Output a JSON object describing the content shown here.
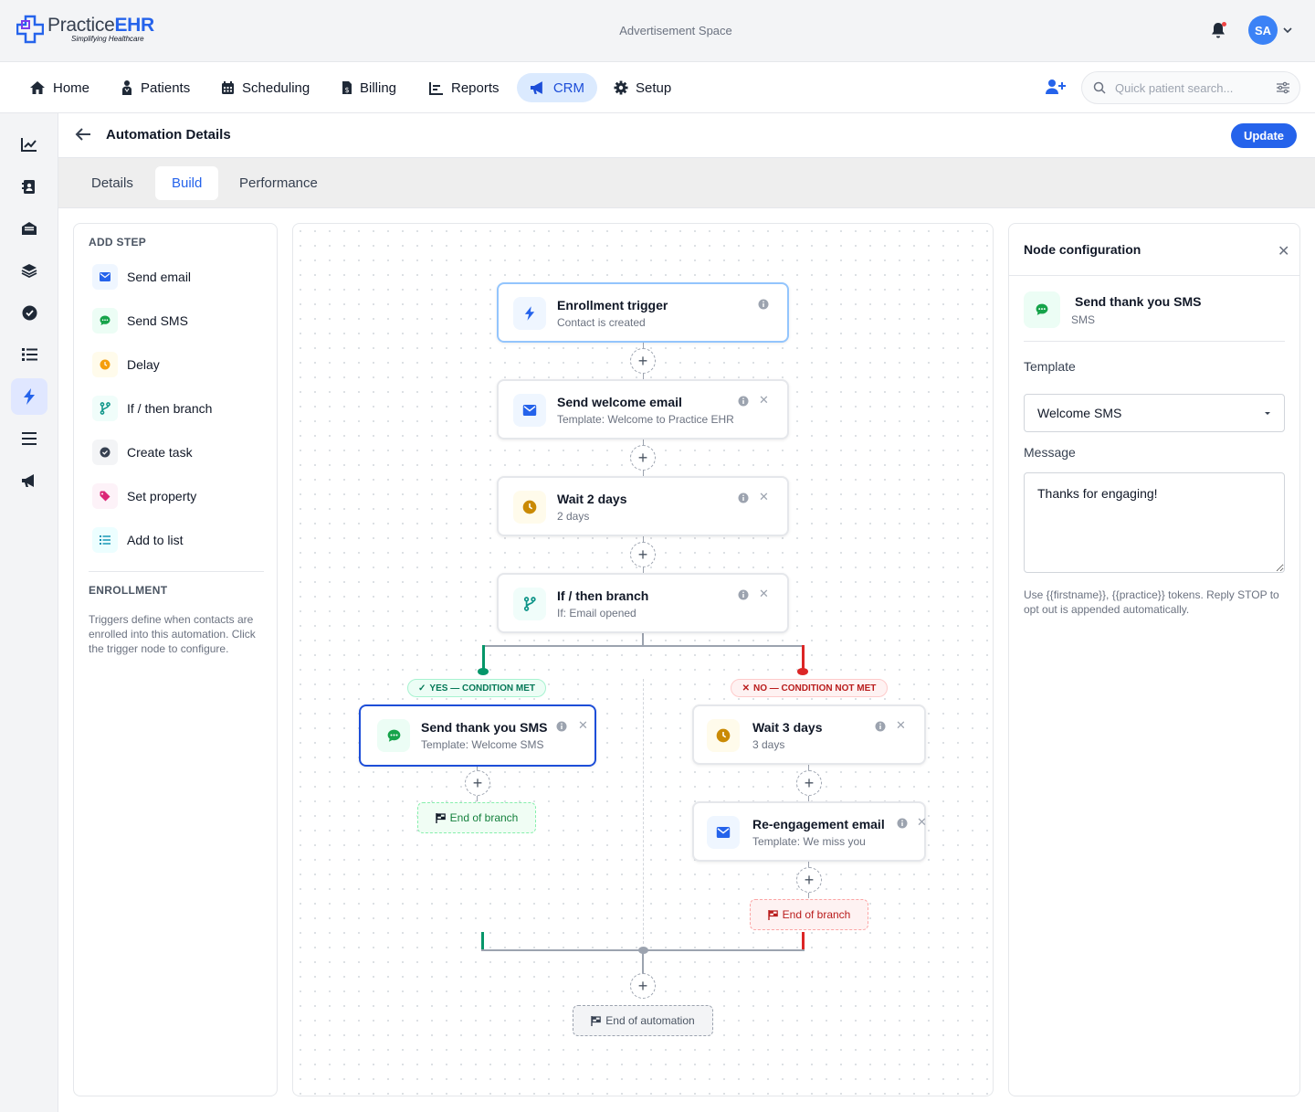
{
  "brand": {
    "name_main": "Practice",
    "name_accent": "EHR",
    "tagline": "Simplifying Healthcare"
  },
  "topbar": {
    "ad_text": "Advertisement Space",
    "avatar_initials": "SA"
  },
  "nav": {
    "items": [
      {
        "label": "Home",
        "icon": "home-icon"
      },
      {
        "label": "Patients",
        "icon": "patients-icon"
      },
      {
        "label": "Scheduling",
        "icon": "calendar-icon"
      },
      {
        "label": "Billing",
        "icon": "billing-icon"
      },
      {
        "label": "Reports",
        "icon": "reports-icon"
      },
      {
        "label": "CRM",
        "icon": "megaphone-icon",
        "active": true
      },
      {
        "label": "Setup",
        "icon": "gear-icon"
      }
    ],
    "search_placeholder": "Quick patient search..."
  },
  "rail": {
    "items": [
      "chart-icon",
      "contacts-icon",
      "inbox-icon",
      "layers-icon",
      "check-circle-icon",
      "list-icon",
      "bolt-icon",
      "menu-icon",
      "megaphone-icon"
    ],
    "active": "bolt-icon"
  },
  "page": {
    "title": "Automation Details",
    "update_label": "Update"
  },
  "tabs": [
    {
      "label": "Details"
    },
    {
      "label": "Build",
      "active": true
    },
    {
      "label": "Performance"
    }
  ],
  "add_step": {
    "title": "ADD STEP",
    "items": [
      {
        "label": "Send email",
        "icon": "mail-icon",
        "color": "#2563eb"
      },
      {
        "label": "Send SMS",
        "icon": "sms-icon",
        "color": "#16a34a"
      },
      {
        "label": "Delay",
        "icon": "clock-icon",
        "color": "#f59e0b"
      },
      {
        "label": "If / then branch",
        "icon": "branch-icon",
        "color": "#0d9488"
      },
      {
        "label": "Create task",
        "icon": "task-icon",
        "color": "#374151"
      },
      {
        "label": "Set property",
        "icon": "tag-icon",
        "color": "#db2777"
      },
      {
        "label": "Add to list",
        "icon": "list-icon",
        "color": "#0891b2"
      }
    ]
  },
  "enrollment": {
    "title": "ENROLLMENT",
    "text": "Triggers define when contacts are enrolled into this automation. Click the trigger node to configure."
  },
  "flow": {
    "nodes": [
      {
        "title": "Enrollment trigger",
        "sub": "Contact is created"
      },
      {
        "title": "Send welcome email",
        "sub": "Template: Welcome to Practice EHR"
      },
      {
        "title": "Wait 2 days",
        "sub": "2 days"
      },
      {
        "title": "If / then branch",
        "sub": "If: Email opened"
      },
      {
        "title": "Send thank you SMS",
        "sub": "Template: Welcome SMS"
      },
      {
        "title": "Wait 3 days",
        "sub": "3 days"
      },
      {
        "title": "Re-engagement email",
        "sub": "Template: We miss you"
      }
    ],
    "yes_label": "YES — CONDITION MET",
    "no_label": "NO — CONDITION NOT MET",
    "end_branch": "End of branch",
    "end_automation": "End of automation"
  },
  "config": {
    "title": "Node configuration",
    "node_title": "Send thank you SMS",
    "node_type": "SMS",
    "template_label": "Template",
    "template_value": "Welcome SMS",
    "message_label": "Message",
    "message_value": "Thanks for engaging!",
    "help": "Use {{firstname}}, {{practice}} tokens. Reply STOP to opt out is appended automatically."
  },
  "colors": {
    "accent": "#2563eb",
    "yes": "#059669",
    "no": "#dc2626"
  }
}
